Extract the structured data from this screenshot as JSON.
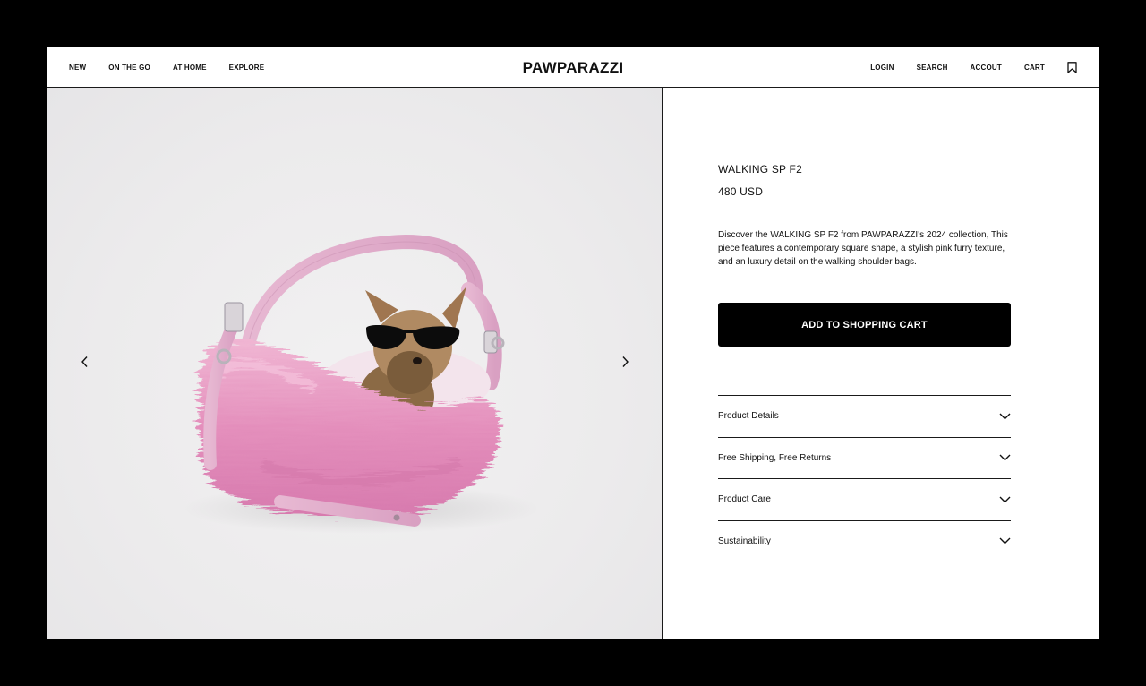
{
  "nav": {
    "left": [
      "NEW",
      "ON THE GO",
      "AT HOME",
      "EXPLORE"
    ],
    "right": [
      "LOGIN",
      "SEARCH",
      "ACCOUT",
      "CART"
    ],
    "brand": "PAWPARAZZI",
    "bookmark_icon": "bookmark-icon"
  },
  "gallery": {
    "prev_icon": "chevron-left-icon",
    "next_icon": "chevron-right-icon",
    "image_subject": "yorkshire terrier with sunglasses in pink furry shoulder bag"
  },
  "product": {
    "name": "WALKING SP F2",
    "price": "480 USD",
    "description": "Discover the WALKING SP F2 from PAWPARAZZI's 2024 collection, This piece features a contemporary square shape, a stylish pink furry texture, and an luxury detail on the walking shoulder bags.",
    "cta": "ADD TO SHOPPING CART"
  },
  "accordion": [
    {
      "label": "Product Details"
    },
    {
      "label": "Free Shipping, Free Returns"
    },
    {
      "label": "Product Care"
    },
    {
      "label": "Sustainability"
    }
  ],
  "colors": {
    "frame_bg": "#000000",
    "page_bg": "#ffffff",
    "button_bg": "#000000",
    "bag_pink": "#e89cc4"
  }
}
